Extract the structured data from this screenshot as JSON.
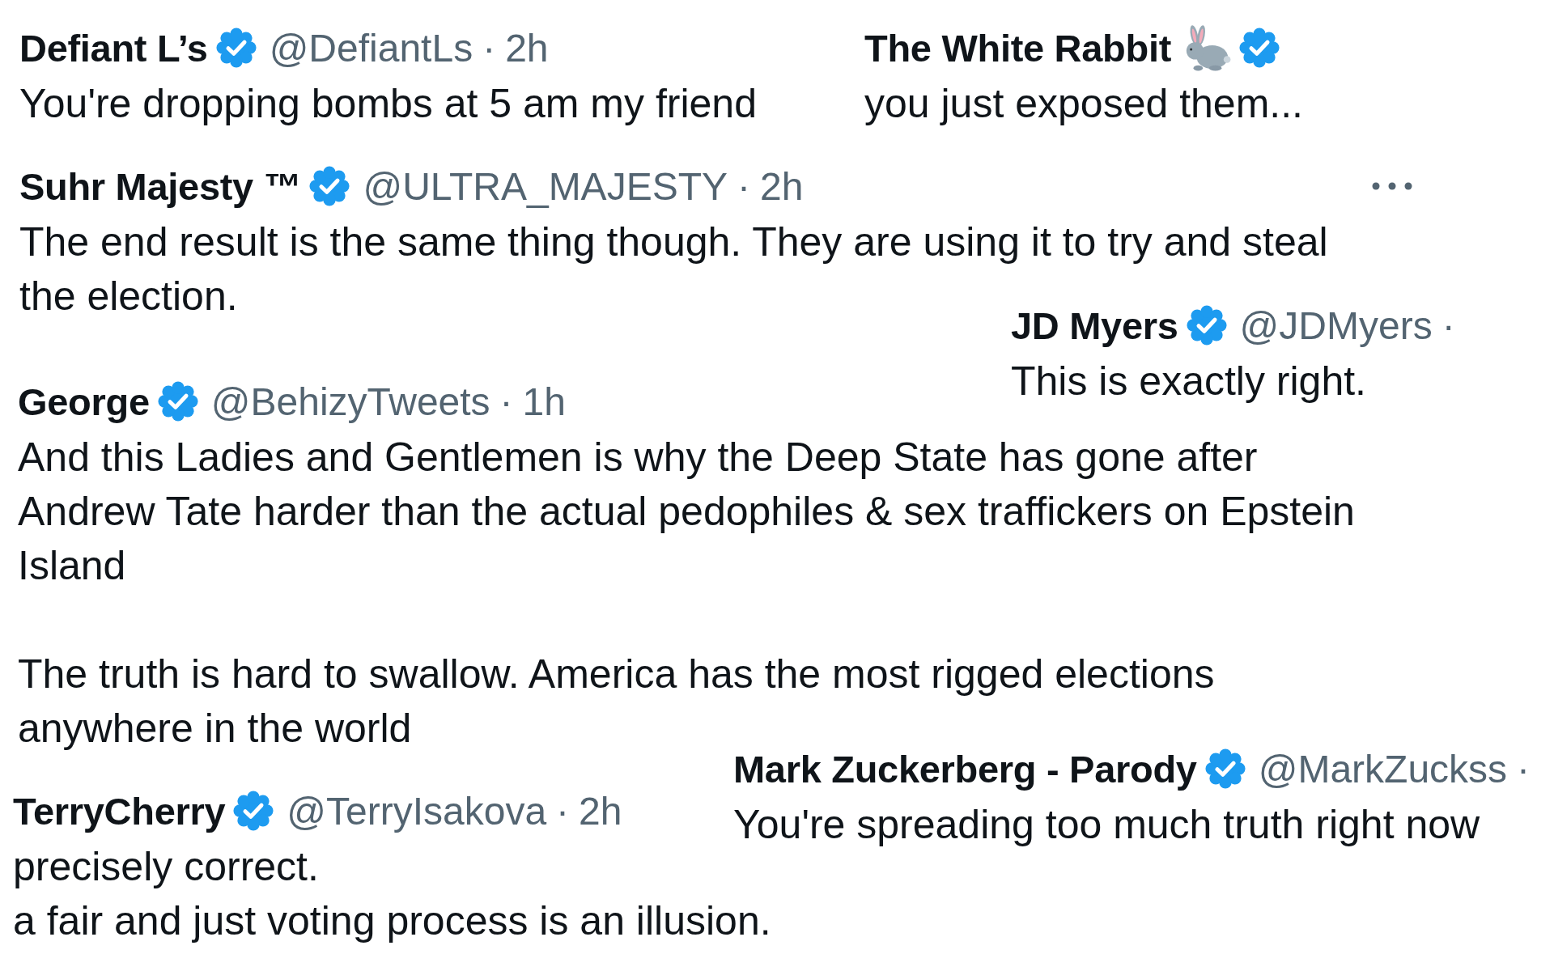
{
  "tweets": [
    {
      "name": "Defiant L’s",
      "verified": true,
      "handle": "@DefiantLs",
      "dot": "·",
      "time": "2h",
      "paragraphs": [
        [
          "You're dropping bombs at 5 am my friend"
        ]
      ]
    },
    {
      "name": "The White Rabbit",
      "name_emoji": true,
      "verified": true,
      "paragraphs": [
        [
          "you just exposed them..."
        ]
      ]
    },
    {
      "name": "Suhr Majesty ™",
      "verified": true,
      "handle": "@ULTRA_MAJESTY",
      "dot": "·",
      "time": "2h",
      "menu": true,
      "paragraphs": [
        [
          "The end result is the same thing though. They are using it to try and steal",
          "the election."
        ]
      ]
    },
    {
      "name": "JD Myers",
      "verified": true,
      "handle": "@JDMyers",
      "dot": "·",
      "paragraphs": [
        [
          "This is exactly right."
        ]
      ]
    },
    {
      "name": "George",
      "verified": true,
      "handle": "@BehizyTweets",
      "dot": "·",
      "time": "1h",
      "paragraphs": [
        [
          "And this Ladies and Gentlemen is why the Deep State has gone after",
          "Andrew Tate harder than the actual pedophiles & sex traffickers on Epstein",
          "Island"
        ],
        [
          "The truth is hard to swallow. America has the most rigged elections",
          "anywhere in the world"
        ]
      ]
    },
    {
      "name": "Mark Zuckerberg - Parody",
      "verified": true,
      "handle": "@MarkZuckss",
      "dot": "·",
      "paragraphs": [
        [
          "You're spreading too much truth right now"
        ]
      ]
    },
    {
      "name": "TerryCherry",
      "verified": true,
      "handle": "@TerryIsakova",
      "dot": "·",
      "time": "2h",
      "paragraphs": [
        [
          "precisely correct.",
          "a fair and just voting process is an illusion."
        ]
      ]
    }
  ]
}
